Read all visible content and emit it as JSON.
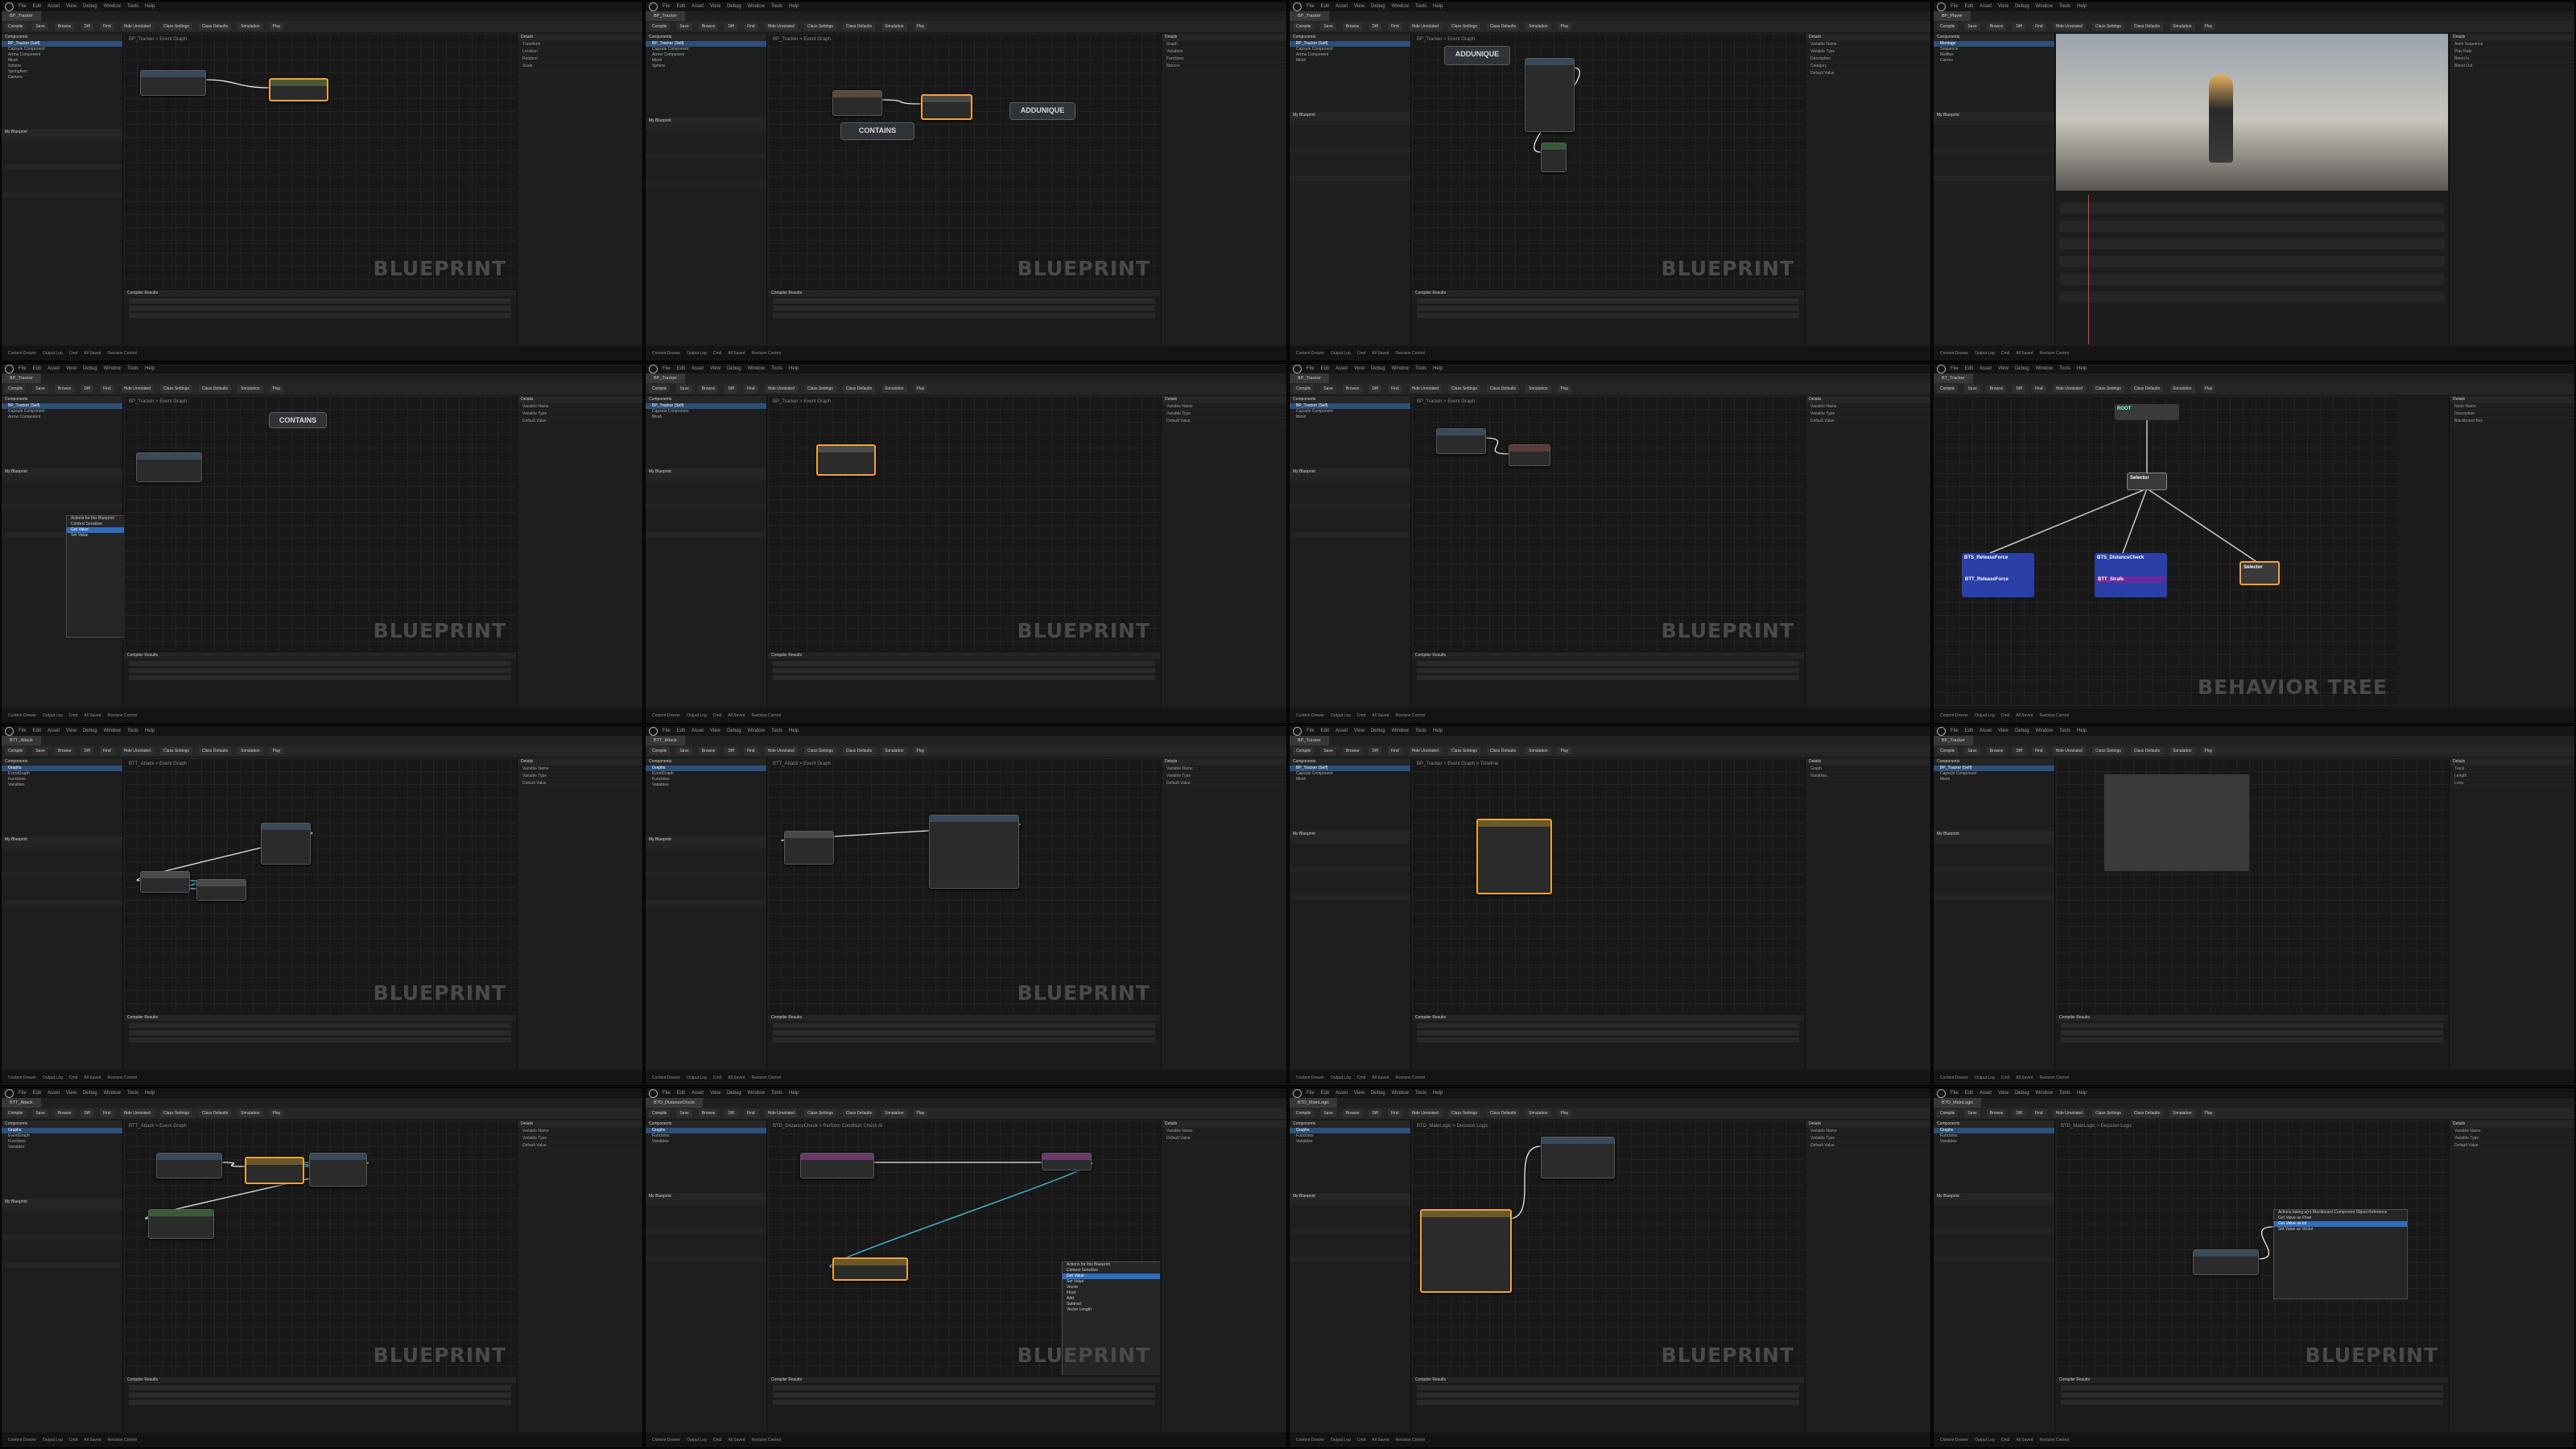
{
  "app": {
    "menu": [
      "File",
      "Edit",
      "Asset",
      "View",
      "Debug",
      "Window",
      "Tools",
      "Help"
    ],
    "toolbar": [
      "Compile",
      "Save",
      "Browse",
      "Diff",
      "Find",
      "Hide Unrelated",
      "Class Settings",
      "Class Defaults",
      "Simulation",
      "Play"
    ],
    "panels": {
      "components": "Components",
      "my_blueprint": "My Blueprint",
      "details": "Details",
      "compiler_results": "Compiler Results",
      "find_results": "Find Results"
    },
    "status": [
      "Content Drawer",
      "Output Log",
      "Cmd",
      "All Saved",
      "Revision Control"
    ]
  },
  "tiles": [
    {
      "tab": "BP_Tracker",
      "crumb": "BP_Tracker > Event Graph",
      "watermark": "BLUEPRINT",
      "nodes": [],
      "big": [],
      "tree": [
        "BP_Tracker (Self)",
        "Capsule Component",
        "Arrow Component",
        "Mesh",
        "Sphere",
        "SpringArm",
        "Camera"
      ],
      "details": [
        "Transform",
        "Location",
        "Rotation",
        "Scale"
      ]
    },
    {
      "tab": "BP_Tracker",
      "crumb": "BP_Tracker > Event Graph",
      "watermark": "BLUEPRINT",
      "nodes": [],
      "big": [
        "CONTAINS",
        "ADDUNIQUE"
      ],
      "tree": [
        "BP_Tracker (Self)",
        "Capsule Component",
        "Arrow Component",
        "Mesh",
        "Sphere"
      ],
      "details": [
        "Graph",
        "Variables",
        "Functions",
        "Macros"
      ]
    },
    {
      "tab": "BP_Tracker",
      "crumb": "BP_Tracker > Event Graph",
      "watermark": "BLUEPRINT",
      "nodes": [],
      "big": [
        "ADDUNIQUE"
      ],
      "tree": [
        "BP_Tracker (Self)",
        "Capsule Component",
        "Arrow Component",
        "Mesh"
      ],
      "details": [
        "Variable Name",
        "Variable Type",
        "Description",
        "Category",
        "Default Value"
      ]
    },
    {
      "tab": "BP_Player",
      "crumb": "",
      "watermark": "",
      "nodes": [],
      "big": [],
      "tree": [
        "Montage",
        "Sequence",
        "Notifies",
        "Curves"
      ],
      "details": [
        "Anim Sequence",
        "Play Rate",
        "Blend In",
        "Blend Out"
      ]
    },
    {
      "tab": "BP_Tracker",
      "crumb": "BP_Tracker > Event Graph",
      "watermark": "BLUEPRINT",
      "nodes": [],
      "big": [
        "CONTAINS"
      ],
      "tree": [
        "BP_Tracker (Self)",
        "Capsule Component",
        "Arrow Component"
      ],
      "details": [
        "Variable Name",
        "Variable Type",
        "Default Value"
      ],
      "menu": [
        "Actions for this Blueprint",
        "Context Sensitive",
        "Get Value",
        "Set Value"
      ]
    },
    {
      "tab": "BP_Tracker",
      "crumb": "BP_Tracker > Event Graph",
      "watermark": "BLUEPRINT",
      "nodes": [],
      "big": [],
      "tree": [
        "BP_Tracker (Self)",
        "Capsule Component",
        "Mesh"
      ],
      "details": [
        "Variable Name",
        "Variable Type",
        "Default Value"
      ]
    },
    {
      "tab": "BP_Tracker",
      "crumb": "BP_Tracker > Event Graph",
      "watermark": "BLUEPRINT",
      "nodes": [],
      "big": [],
      "tree": [
        "BP_Tracker (Self)",
        "Capsule Component",
        "Mesh"
      ],
      "details": [
        "Variable Name",
        "Variable Type",
        "Default Value"
      ]
    },
    {
      "tab": "BT_Tracker",
      "crumb": "",
      "watermark": "BEHAVIOR TREE",
      "nodes": [],
      "big": [],
      "tree": [],
      "details": [
        "Node Name",
        "Description",
        "Blackboard Key"
      ],
      "bt": {
        "root": "ROOT",
        "selector": "Selector",
        "tasks": [
          "BTS_ReleaseForce",
          "BTS_DistanceCheck",
          "Selector"
        ],
        "sub": [
          "BTT_ReleaseForce",
          "BTT_Strafe",
          ""
        ]
      }
    },
    {
      "tab": "BTT_Attack",
      "crumb": "BTT_Attack > Event Graph",
      "watermark": "BLUEPRINT",
      "nodes": [],
      "big": [],
      "tree": [
        "Graphs",
        "EventGraph",
        "Functions",
        "Variables"
      ],
      "details": [
        "Variable Name",
        "Variable Type",
        "Default Value"
      ]
    },
    {
      "tab": "BTT_Attack",
      "crumb": "BTT_Attack > Event Graph",
      "watermark": "BLUEPRINT",
      "nodes": [],
      "big": [],
      "tree": [
        "Graphs",
        "EventGraph",
        "Functions",
        "Variables"
      ],
      "details": [
        "Variable Name",
        "Variable Type",
        "Default Value"
      ]
    },
    {
      "tab": "BP_Tracker",
      "crumb": "BP_Tracker > Event Graph > Timeline",
      "watermark": "",
      "nodes": [],
      "big": [],
      "tree": [
        "BP_Tracker (Self)",
        "Capsule Component",
        "Mesh"
      ],
      "details": [
        "Graph",
        "Variables"
      ]
    },
    {
      "tab": "BP_Tracker",
      "crumb": "",
      "watermark": "",
      "nodes": [],
      "big": [],
      "tree": [
        "BP_Tracker (Self)",
        "Capsule Component",
        "Mesh"
      ],
      "details": [
        "Track",
        "Length",
        "Loop"
      ]
    },
    {
      "tab": "BTT_Attack",
      "crumb": "BTT_Attack > Event Graph",
      "watermark": "BLUEPRINT",
      "nodes": [],
      "big": [],
      "tree": [
        "Graphs",
        "EventGraph",
        "Functions",
        "Variables"
      ],
      "details": [
        "Variable Name",
        "Variable Type",
        "Default Value"
      ]
    },
    {
      "tab": "BTD_DistanceCheck",
      "crumb": "BTD_DistanceCheck > Perform Condition Check AI",
      "watermark": "BLUEPRINT",
      "nodes": [],
      "big": [],
      "tree": [
        "Graphs",
        "Functions",
        "Variables"
      ],
      "details": [
        "Variable Name",
        "Default Value"
      ],
      "menu": [
        "Actions for this Blueprint",
        "Context Sensitive",
        "Get Value",
        "Set Value",
        "Vector",
        "Float",
        "Add",
        "Subtract",
        "Vector Length"
      ]
    },
    {
      "tab": "BTD_MainLogic",
      "crumb": "BTD_MainLogic > Decision Logic",
      "watermark": "BLUEPRINT",
      "nodes": [],
      "big": [],
      "tree": [
        "Graphs",
        "Functions",
        "Variables"
      ],
      "details": [
        "Variable Name",
        "Variable Type",
        "Default Value"
      ]
    },
    {
      "tab": "BTD_MainLogic",
      "crumb": "BTD_MainLogic > Decision Logic",
      "watermark": "BLUEPRINT",
      "nodes": [],
      "big": [],
      "tree": [
        "Graphs",
        "Functions",
        "Variables"
      ],
      "details": [
        "Variable Name",
        "Variable Type",
        "Default Value"
      ],
      "menu": [
        "Actions taking a(n) Blackboard Component Object Reference",
        "Get Value as Float",
        "Get Value as Int",
        "Set Value as Vector"
      ]
    }
  ]
}
